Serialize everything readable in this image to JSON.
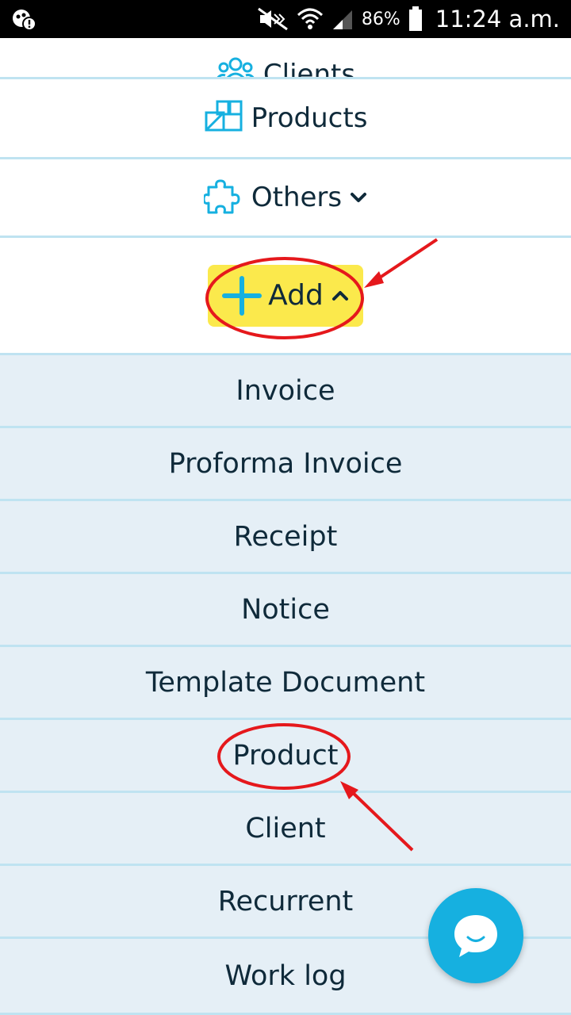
{
  "status_bar": {
    "battery_percent": "86%",
    "time": "11:24 a.m."
  },
  "menu": {
    "clients_label": "Clients",
    "products_label": "Products",
    "others_label": "Others",
    "add_label": "Add"
  },
  "add_submenu": [
    {
      "label": "Invoice"
    },
    {
      "label": "Proforma Invoice"
    },
    {
      "label": "Receipt"
    },
    {
      "label": "Notice"
    },
    {
      "label": "Template Document"
    },
    {
      "label": "Product"
    },
    {
      "label": "Client"
    },
    {
      "label": "Recurrent"
    },
    {
      "label": "Work log"
    }
  ],
  "colors": {
    "accent": "#16b0e0",
    "highlight": "#fbe94c",
    "submenu_bg": "#e5eff6",
    "annotation_red": "#e5181c"
  }
}
